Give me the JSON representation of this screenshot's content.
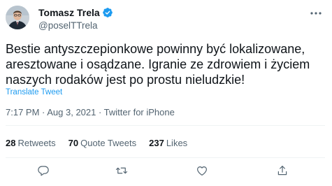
{
  "author": {
    "display_name": "Tomasz Trela",
    "handle": "@poselTTrela",
    "verified": true
  },
  "tweet": {
    "text": "Bestie antyszczepionkowe powinny być lokalizowane, aresztowane i osądzane. Igranie ze zdrowiem i życiem naszych rodaków jest po prostu nieludzkie!",
    "translate_label": "Translate Tweet",
    "meta": "7:17 PM · Aug 3, 2021 · Twitter for iPhone"
  },
  "stats": {
    "retweets_count": "28",
    "retweets_label": "Retweets",
    "quotes_count": "70",
    "quotes_label": "Quote Tweets",
    "likes_count": "237",
    "likes_label": "Likes"
  },
  "actions": {
    "icons": [
      "reply-icon",
      "retweet-icon",
      "like-icon",
      "share-icon"
    ]
  },
  "colors": {
    "accent": "#1d9bf0",
    "secondary_text": "#536471",
    "primary_text": "#0f1419"
  }
}
